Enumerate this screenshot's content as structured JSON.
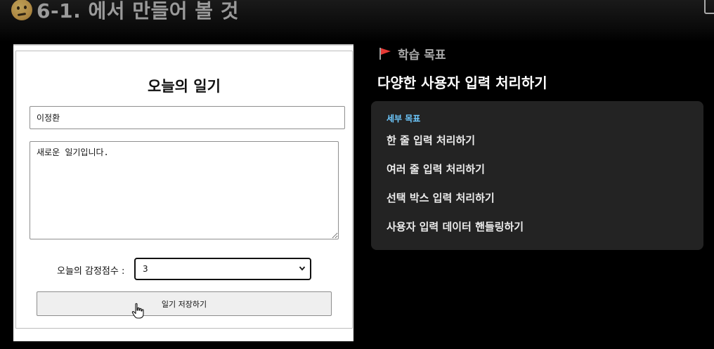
{
  "header": {
    "title": "6-1. 에서 만들어 볼 것",
    "emoji_icon": "thinking-face-icon"
  },
  "diary": {
    "title": "오늘의 일기",
    "author_value": "이정환",
    "content_value": "새로운 일기입니다.",
    "emotion_label": "오늘의 감정점수 :",
    "emotion_selected": "3",
    "save_label": "일기 저장하기"
  },
  "objective": {
    "heading": "학습 목표",
    "main": "다양한 사용자 입력 처리하기",
    "detail_label": "세부 목표",
    "items": [
      "한 줄 입력 처리하기",
      "여러 줄 입력 처리하기",
      "선택 박스 입력 처리하기",
      "사용자 입력 데이터 핸들링하기"
    ]
  },
  "colors": {
    "background": "#000000",
    "card": "#232323",
    "accent": "#6ec9ff",
    "flag": "#e53935"
  }
}
